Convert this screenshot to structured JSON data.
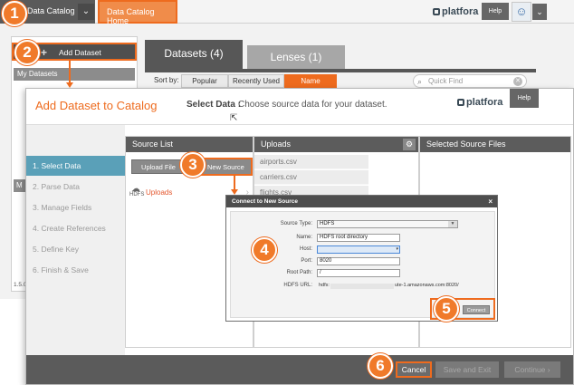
{
  "background_app": {
    "nav_catalog": "Data Catalog",
    "nav_chevron": "⌄",
    "nav_home": "Data Catalog Home",
    "brand": "platfora",
    "help": "Help",
    "sidebar": {
      "add_dataset": "Add Dataset",
      "add_icon": "+",
      "my_datasets": "My Datasets",
      "section_m": "M",
      "version": "1.5.0-b"
    },
    "tabs": [
      {
        "label": "Datasets (4)"
      },
      {
        "label": "Lenses (1)"
      }
    ],
    "sort_by": "Sort by:",
    "sort_options": [
      "Popular",
      "Recently Used",
      "Name"
    ],
    "quick_find_placeholder": "Quick Find"
  },
  "dialog": {
    "title": "Add Dataset to Catalog",
    "step_label": "Select Data :",
    "step_text": "Choose source data for your dataset.",
    "brand": "platfora",
    "help": "Help",
    "steps": [
      "1. Select Data",
      "2. Parse Data",
      "3. Manage Fields",
      "4. Create References",
      "5. Define Key",
      "6. Finish & Save"
    ],
    "source_list": {
      "header": "Source List",
      "upload_file": "Upload File",
      "new_source": "New Source",
      "hdfs_icon_label": "HDFS",
      "source_item": "Uploads"
    },
    "uploads": {
      "header": "Uploads",
      "files": [
        "airports.csv",
        "carriers.csv",
        "flights.csv"
      ]
    },
    "selected_files": {
      "header": "Selected Source Files"
    },
    "footer": {
      "cancel": "Cancel",
      "save_and_exit": "Save and Exit",
      "continue": "Continue"
    }
  },
  "connect_modal": {
    "title": "Connect to New Source",
    "close": "×",
    "fields": {
      "source_type_label": "Source Type:",
      "source_type_value": "HDFS",
      "name_label": "Name:",
      "name_value": "HDFS root directory",
      "host_label": "Host:",
      "host_value": "",
      "port_label": "Port:",
      "port_value": "8020",
      "root_path_label": "Root Path:",
      "root_path_value": "/",
      "hdfs_url_label": "HDFS URL:",
      "hdfs_url_prefix": "hdfs:",
      "hdfs_url_suffix": "ute-1.amazonaws.com:8020/"
    },
    "connect_button": "Connect"
  },
  "annotations": [
    "1",
    "2",
    "3",
    "4",
    "5",
    "6"
  ],
  "colors": {
    "accent": "#ee6b1e",
    "active_step": "#5aa0b8",
    "panel_header": "#5c5c5c"
  }
}
